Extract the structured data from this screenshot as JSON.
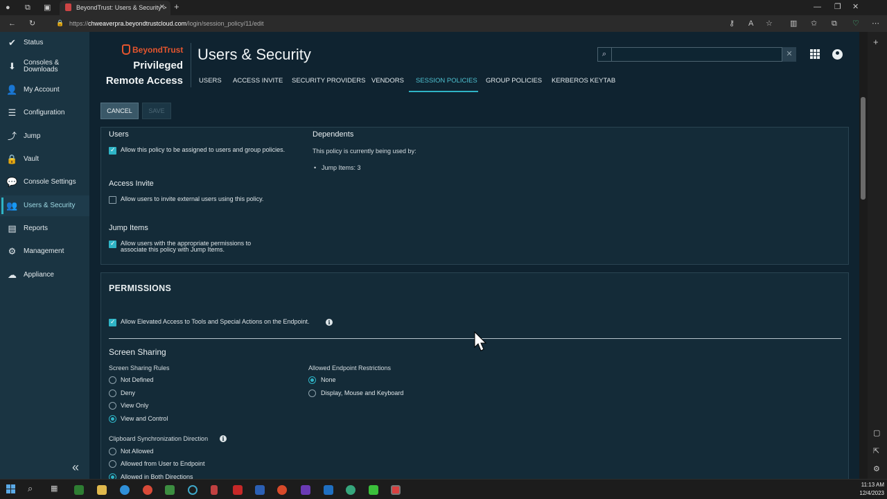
{
  "browser": {
    "tab_title": "BeyondTrust: Users & Security >",
    "url_host": "chweaverpra.beyondtrustcloud.com",
    "url_path": "/login/session_policy/11/edit",
    "url_scheme": "https://"
  },
  "sidebar": {
    "items": [
      {
        "label": "Status",
        "icon": "check-circle-icon"
      },
      {
        "label": "Consoles & Downloads",
        "icon": "download-icon"
      },
      {
        "label": "My Account",
        "icon": "user-icon"
      },
      {
        "label": "Configuration",
        "icon": "sliders-icon"
      },
      {
        "label": "Jump",
        "icon": "jump-icon"
      },
      {
        "label": "Vault",
        "icon": "lock-icon"
      },
      {
        "label": "Console Settings",
        "icon": "chat-icon"
      },
      {
        "label": "Users & Security",
        "icon": "users-icon"
      },
      {
        "label": "Reports",
        "icon": "report-icon"
      },
      {
        "label": "Management",
        "icon": "gear-icon"
      },
      {
        "label": "Appliance",
        "icon": "cloud-icon"
      }
    ],
    "collapse_glyph": "«"
  },
  "header": {
    "brand": "BeyondTrust",
    "product_line1": "Privileged",
    "product_line2": "Remote Access",
    "title": "Users & Security",
    "tabs": [
      "USERS",
      "ACCESS INVITE",
      "SECURITY PROVIDERS",
      "VENDORS",
      "SESSION POLICIES",
      "GROUP POLICIES",
      "KERBEROS KEYTAB"
    ],
    "active_tab": "SESSION POLICIES"
  },
  "actions": {
    "cancel": "CANCEL",
    "save": "SAVE"
  },
  "availability": {
    "users_heading": "Users",
    "users_option": "Allow this policy to be assigned to users and group policies.",
    "users_checked": true,
    "access_invite_heading": "Access Invite",
    "access_invite_option": "Allow users to invite external users using this policy.",
    "access_invite_checked": false,
    "jump_items_heading": "Jump Items",
    "jump_items_option": "Allow users with the appropriate permissions to associate this policy with Jump Items.",
    "jump_items_checked": true,
    "dependents_heading": "Dependents",
    "dependents_text": "This policy is currently being used by:",
    "dependents_item": "Jump Items: 3"
  },
  "permissions": {
    "heading": "PERMISSIONS",
    "elevated_option": "Allow Elevated Access to Tools and Special Actions on the Endpoint.",
    "elevated_checked": true,
    "screen_sharing_heading": "Screen Sharing",
    "rules_label": "Screen Sharing Rules",
    "rules": [
      "Not Defined",
      "Deny",
      "View Only",
      "View and Control"
    ],
    "rules_selected": "View and Control",
    "restrictions_label": "Allowed Endpoint Restrictions",
    "restrictions": [
      "None",
      "Display, Mouse and Keyboard"
    ],
    "restrictions_selected": "None",
    "clipboard_label": "Clipboard Synchronization Direction",
    "clipboard": [
      "Not Allowed",
      "Allowed from User to Endpoint",
      "Allowed in Both Directions"
    ],
    "clipboard_selected": "Allowed in Both Directions"
  },
  "taskbar": {
    "time": "11:13 AM",
    "date": "12/4/2023"
  },
  "colors": {
    "accent": "#2fb4c6",
    "brand": "#e4552e",
    "background": "#0f2330"
  }
}
